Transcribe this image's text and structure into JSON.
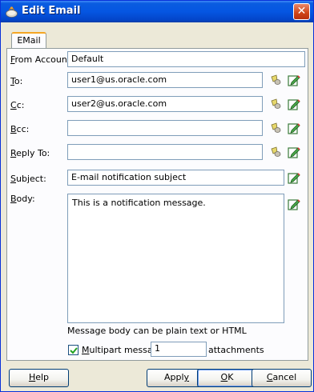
{
  "window": {
    "title": "Edit Email",
    "close_glyph": "✕"
  },
  "tabs": [
    {
      "label": "EMail",
      "active": true
    }
  ],
  "form": {
    "from_account": {
      "label_key": "F",
      "label_rest": "rom Account:",
      "value": "Default"
    },
    "to": {
      "label_key": "T",
      "label_rest": "o:",
      "value": "user1@us.oracle.com"
    },
    "cc": {
      "label_key": "C",
      "label_rest": "c:",
      "value": "user2@us.oracle.com"
    },
    "bcc": {
      "label_key": "B",
      "label_rest": "cc:",
      "value": ""
    },
    "reply_to": {
      "label_key": "R",
      "label_rest": "eply To:",
      "value": ""
    },
    "subject": {
      "label_key": "S",
      "label_rest": "ubject:",
      "value": "E-mail notification subject"
    },
    "body": {
      "label_key": "B",
      "label_rest": "ody:",
      "value": "This is a notification message."
    },
    "body_hint": "Message body can be plain text or HTML",
    "multipart": {
      "checked": true,
      "label_key": "M",
      "label_rest": "ultipart message",
      "count": "1",
      "suffix": "attachments"
    }
  },
  "icons": {
    "lookup": "flashlight-icon",
    "edit": "edit-expression-icon"
  },
  "buttons": {
    "help": {
      "key": "H",
      "rest": "elp"
    },
    "apply": {
      "pre": "Appl",
      "key": "y",
      "rest": ""
    },
    "ok": {
      "key": "O",
      "rest": "K"
    },
    "cancel": {
      "key": "C",
      "rest": "ancel"
    }
  },
  "colors": {
    "title_bar": "#0556e2",
    "tab_accent": "#f5a623",
    "field_border": "#7f9db9",
    "dialog_bg": "#ece9d8"
  }
}
